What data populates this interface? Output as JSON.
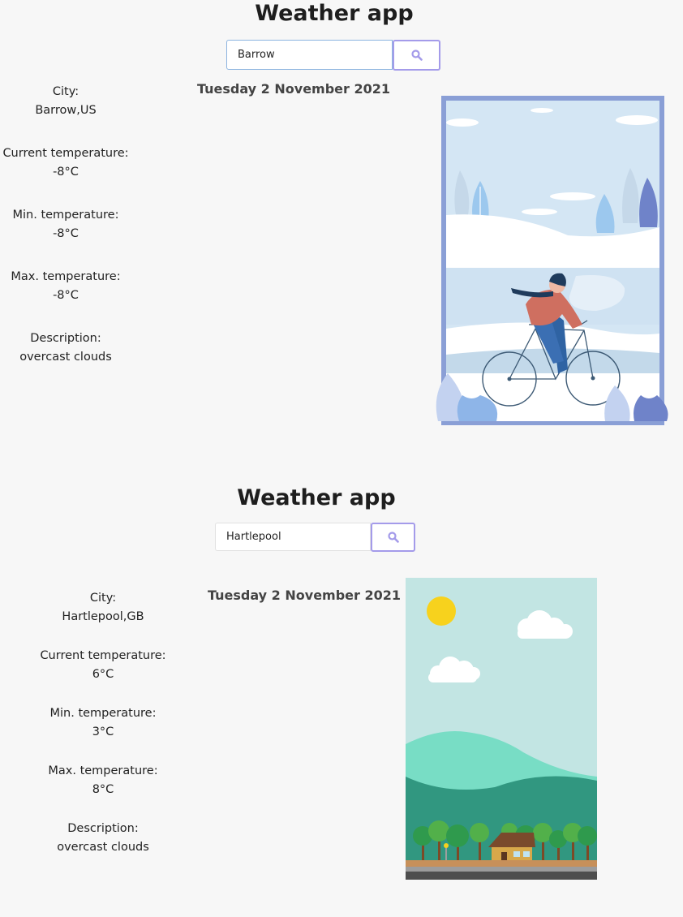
{
  "app1": {
    "title": "Weather app",
    "search": {
      "value": "Barrow",
      "icon": "search-icon"
    },
    "date": "Tuesday 2 November 2021",
    "fields": [
      {
        "label": "City:",
        "value": "Barrow,US"
      },
      {
        "label": "Current temperature:",
        "value": "-8°C"
      },
      {
        "label": "Min. temperature:",
        "value": "-8°C"
      },
      {
        "label": "Max. temperature:",
        "value": "-8°C"
      },
      {
        "label": "Description:",
        "value": "overcast clouds"
      }
    ],
    "illustration": "winter-cyclist-illustration"
  },
  "app2": {
    "title": "Weather app",
    "search": {
      "value": "Hartlepool",
      "icon": "search-icon"
    },
    "date": "Tuesday 2 November 2021",
    "fields": [
      {
        "label": "City:",
        "value": "Hartlepool,GB"
      },
      {
        "label": "Current temperature:",
        "value": "6°C"
      },
      {
        "label": "Min. temperature:",
        "value": "3°C"
      },
      {
        "label": "Max. temperature:",
        "value": "8°C"
      },
      {
        "label": "Description:",
        "value": "overcast clouds"
      }
    ],
    "illustration": "sunny-countryside-illustration"
  },
  "colors": {
    "accent": "#a49bea",
    "input_focus_border": "#8db4e0",
    "frame": "#8a9fd6"
  }
}
